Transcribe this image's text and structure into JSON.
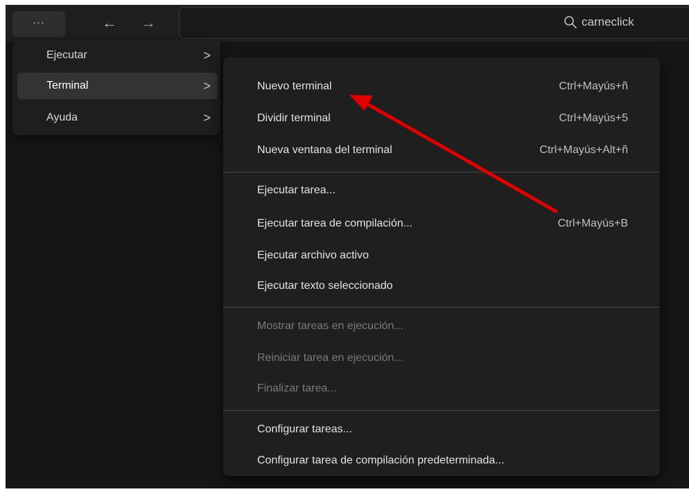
{
  "titlebar": {
    "more_label": "···",
    "back_icon": "arrow-left-icon",
    "forward_icon": "arrow-right-icon",
    "search_text": "carneclick"
  },
  "menubar": {
    "items": [
      {
        "label": "Ejecutar",
        "chevron": ">"
      },
      {
        "label": "Terminal",
        "chevron": ">"
      },
      {
        "label": "Ayuda",
        "chevron": ">"
      }
    ]
  },
  "terminal_menu": {
    "groups": [
      [
        {
          "label": "Nuevo terminal",
          "shortcut": "Ctrl+Mayús+ñ"
        },
        {
          "label": "Dividir terminal",
          "shortcut": "Ctrl+Mayús+5"
        },
        {
          "label": "Nueva ventana del terminal",
          "shortcut": "Ctrl+Mayús+Alt+ñ"
        }
      ],
      [
        {
          "label": "Ejecutar tarea...",
          "shortcut": ""
        },
        {
          "label": "Ejecutar tarea de compilación...",
          "shortcut": "Ctrl+Mayús+B"
        },
        {
          "label": "Ejecutar archivo activo",
          "shortcut": ""
        },
        {
          "label": "Ejecutar texto seleccionado",
          "shortcut": ""
        }
      ],
      [
        {
          "label": "Mostrar tareas en ejecución...",
          "shortcut": ""
        },
        {
          "label": "Reiniciar tarea en ejecución...",
          "shortcut": ""
        },
        {
          "label": "Finalizar tarea...",
          "shortcut": ""
        }
      ],
      [
        {
          "label": "Configurar tareas...",
          "shortcut": ""
        },
        {
          "label": "Configurar tarea de compilación predeterminada...",
          "shortcut": ""
        }
      ]
    ]
  },
  "colors": {
    "annotation_arrow": "#e00000"
  }
}
